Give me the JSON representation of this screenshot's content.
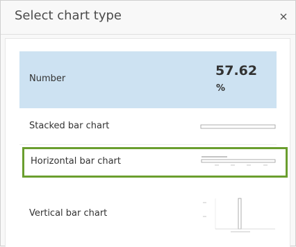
{
  "dialog": {
    "title": "Select chart type",
    "close_icon": "close-icon"
  },
  "options": [
    {
      "label": "Number",
      "value": "57.62",
      "unit": "%",
      "state": "highlighted"
    },
    {
      "label": "Stacked bar chart"
    },
    {
      "label": "Horizontal bar chart",
      "state": "selected-outline"
    },
    {
      "label": "Vertical bar chart"
    }
  ],
  "colors": {
    "highlight": "#cde2f2",
    "selection_outline": "#6a9e2e"
  }
}
